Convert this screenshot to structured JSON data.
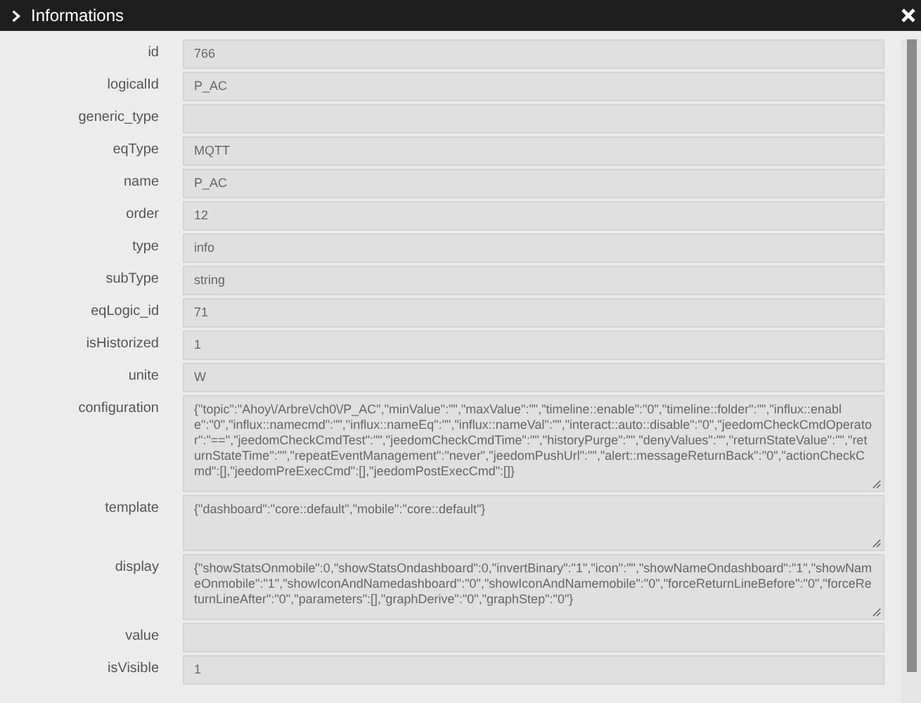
{
  "window": {
    "title": "Informations"
  },
  "fields": [
    {
      "label": "id",
      "value": "766",
      "kind": "text"
    },
    {
      "label": "logicalId",
      "value": "P_AC",
      "kind": "text"
    },
    {
      "label": "generic_type",
      "kind": "text"
    },
    {
      "label": "eqType",
      "value": "MQTT",
      "kind": "text"
    },
    {
      "label": "name",
      "value": "P_AC",
      "kind": "text"
    },
    {
      "label": "order",
      "value": "12",
      "kind": "text"
    },
    {
      "label": "type",
      "value": "info",
      "kind": "text"
    },
    {
      "label": "subType",
      "value": "string",
      "kind": "text"
    },
    {
      "label": "eqLogic_id",
      "value": "71",
      "kind": "text"
    },
    {
      "label": "isHistorized",
      "value": "1",
      "kind": "text"
    },
    {
      "label": "unite",
      "value": "W",
      "kind": "text"
    },
    {
      "label": "configuration",
      "value": "{\"topic\":\"Ahoy\\/Arbre\\/ch0\\/P_AC\",\"minValue\":\"\",\"maxValue\":\"\",\"timeline::enable\":\"0\",\"timeline::folder\":\"\",\"influx::enable\":\"0\",\"influx::namecmd\":\"\",\"influx::nameEq\":\"\",\"influx::nameVal\":\"\",\"interact::auto::disable\":\"0\",\"jeedomCheckCmdOperator\":\"==\",\"jeedomCheckCmdTest\":\"\",\"jeedomCheckCmdTime\":\"\",\"historyPurge\":\"\",\"denyValues\":\"\",\"returnStateValue\":\"\",\"returnStateTime\":\"\",\"repeatEventManagement\":\"never\",\"jeedomPushUrl\":\"\",\"alert::messageReturnBack\":\"0\",\"actionCheckCmd\":[],\"jeedomPreExecCmd\":[],\"jeedomPostExecCmd\":[]}",
      "kind": "textarea"
    },
    {
      "label": "template",
      "value": "{\"dashboard\":\"core::default\",\"mobile\":\"core::default\"}",
      "kind": "textarea"
    },
    {
      "label": "display",
      "value": "{\"showStatsOnmobile\":0,\"showStatsOndashboard\":0,\"invertBinary\":\"1\",\"icon\":\"\",\"showNameOndashboard\":\"1\",\"showNameOnmobile\":\"1\",\"showIconAndNamedashboard\":\"0\",\"showIconAndNamemobile\":\"0\",\"forceReturnLineBefore\":\"0\",\"forceReturnLineAfter\":\"0\",\"parameters\":[],\"graphDerive\":\"0\",\"graphStep\":\"0\"}",
      "kind": "textarea"
    },
    {
      "label": "value",
      "kind": "text"
    },
    {
      "label": "isVisible",
      "value": "1",
      "kind": "text"
    }
  ]
}
